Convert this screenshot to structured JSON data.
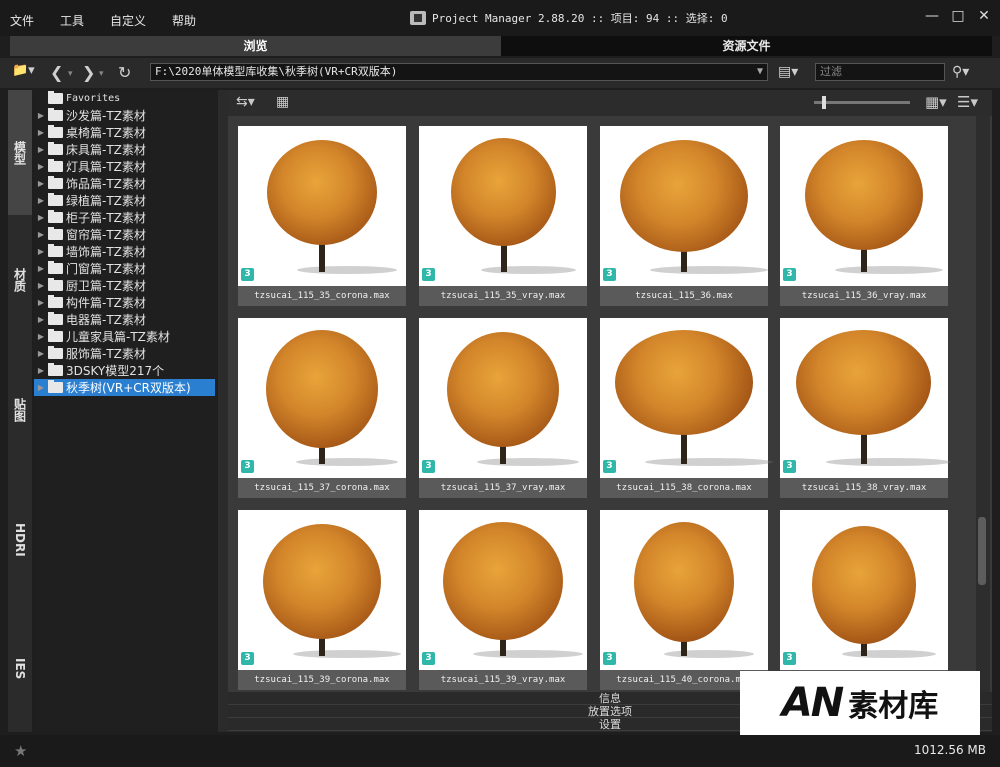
{
  "menu": [
    "文件",
    "工具",
    "自定义",
    "帮助"
  ],
  "app": {
    "title": "Project Manager 2.88.20  :: 项目: 94  :: 选择: 0"
  },
  "window_controls": [
    "minimize-icon",
    "maximize-icon",
    "close-icon"
  ],
  "tabs": [
    {
      "label": "浏览",
      "active": true
    },
    {
      "label": "资源文件",
      "active": false
    }
  ],
  "navbar": {
    "path": "F:\\2020单体模型库收集\\秋季树(VR+CR双版本)",
    "search_placeholder": "过滤"
  },
  "sidetabs": [
    "模型",
    "材质",
    "贴图",
    "HDRI",
    "IES"
  ],
  "tree": {
    "favorites": "Favorites",
    "items": [
      "沙发篇-TZ素材",
      "桌椅篇-TZ素材",
      "床具篇-TZ素材",
      "灯具篇-TZ素材",
      "饰品篇-TZ素材",
      "绿植篇-TZ素材",
      "柜子篇-TZ素材",
      "窗帘篇-TZ素材",
      "墙饰篇-TZ素材",
      "门窗篇-TZ素材",
      "厨卫篇-TZ素材",
      "构件篇-TZ素材",
      "电器篇-TZ素材",
      "儿童家具篇-TZ素材",
      "服饰篇-TZ素材",
      "3DSKY模型217个",
      "秋季树(VR+CR双版本)"
    ],
    "selected": "秋季树(VR+CR双版本)"
  },
  "files": [
    "tzsucai_115_35_corona.max",
    "tzsucai_115_35_vray.max",
    "tzsucai_115_36.max",
    "tzsucai_115_36_vray.max",
    "tzsucai_115_37_corona.max",
    "tzsucai_115_37_vray.max",
    "tzsucai_115_38_corona.max",
    "tzsucai_115_38_vray.max",
    "tzsucai_115_39_corona.max",
    "tzsucai_115_39_vray.max",
    "tzsucai_115_40_corona.max",
    ""
  ],
  "file_badge": "3",
  "panels": [
    "信息",
    "放置选项",
    "设置"
  ],
  "status": {
    "size": "1012.56 MB"
  },
  "watermark": {
    "an": "AN",
    "cn": "素材库"
  },
  "colors": {
    "selection": "#2a7fd0",
    "badge": "#2fb7a9",
    "foliage": "#d3862a"
  }
}
